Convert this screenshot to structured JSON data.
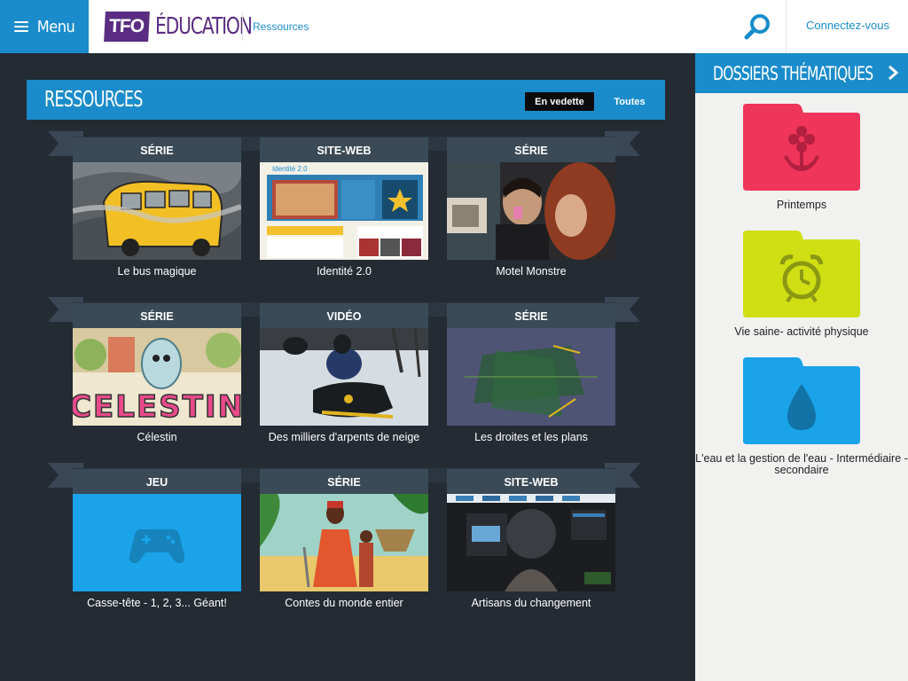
{
  "header": {
    "menu_label": "Menu",
    "logo_tfo": "TFO",
    "logo_education": "ÉDUCATION",
    "breadcrumb": "Ressources",
    "login_label": "Connectez-vous"
  },
  "sidebar": {
    "title": "DOSSIERS THÉMATIQUES",
    "folders": [
      {
        "label": "Printemps",
        "color": "#f0355a",
        "icon": "flower-icon"
      },
      {
        "label": "Vie saine- activité physique",
        "color": "#cfdf14",
        "icon": "alarm-clock-icon"
      },
      {
        "label": "L'eau et la gestion de l'eau - Intermédiaire -secondaire",
        "color": "#1aa3e8",
        "icon": "water-drop-icon"
      }
    ]
  },
  "main": {
    "title": "RESSOURCES",
    "tab_featured": "En vedette",
    "tab_all": "Toutes",
    "cards": [
      {
        "type": "SÉRIE",
        "title": "Le bus magique"
      },
      {
        "type": "SITE-WEB",
        "title": "Identité 2.0"
      },
      {
        "type": "SÉRIE",
        "title": "Motel Monstre"
      },
      {
        "type": "SÉRIE",
        "title": "Célestin"
      },
      {
        "type": "VIDÉO",
        "title": "Des milliers d'arpents de neige"
      },
      {
        "type": "SÉRIE",
        "title": "Les droites et les plans"
      },
      {
        "type": "JEU",
        "title": "Casse-tête - 1, 2, 3... Géant!"
      },
      {
        "type": "SÉRIE",
        "title": "Contes du monde entier"
      },
      {
        "type": "SITE-WEB",
        "title": "Artisans du changement"
      }
    ],
    "thumb_text": {
      "identite_header": "Identité 2.0",
      "celestin_word": "CELESTIN"
    }
  },
  "colors": {
    "brand_blue": "#1a8ccb",
    "brand_purple": "#5a2d82",
    "background": "#242b33",
    "card_label_bg": "#3a4a56"
  }
}
